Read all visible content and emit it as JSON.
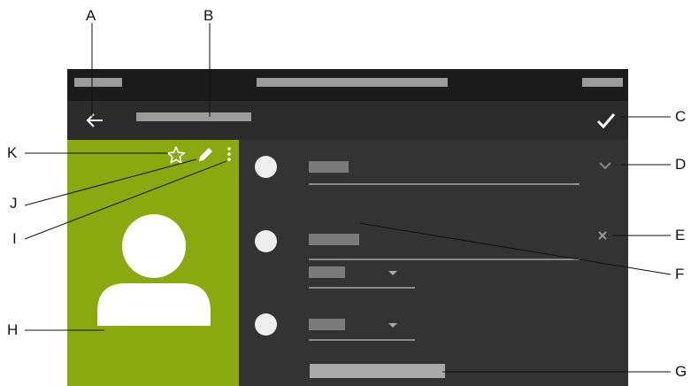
{
  "callouts": {
    "a": "A",
    "b": "B",
    "c": "C",
    "d": "D",
    "e": "E",
    "f": "F",
    "g": "G",
    "h": "H",
    "i": "I",
    "j": "J",
    "k": "K"
  },
  "icons": {
    "back": "back-arrow-icon",
    "confirm": "checkmark-icon",
    "favorite": "star-outline-icon",
    "edit": "pencil-icon",
    "more": "more-vertical-icon",
    "expand": "chevron-down-icon",
    "clear": "close-icon",
    "dropdown": "caret-down-icon",
    "avatar": "person-icon"
  },
  "colors": {
    "screen_bg": "#222222",
    "status_bar": "#1b1b1b",
    "toolbar": "#2b2b2b",
    "contact_card": "#8aa80f",
    "form_panel": "#333333",
    "placeholder": "#9b9b9b",
    "callout_line": "#111111"
  }
}
